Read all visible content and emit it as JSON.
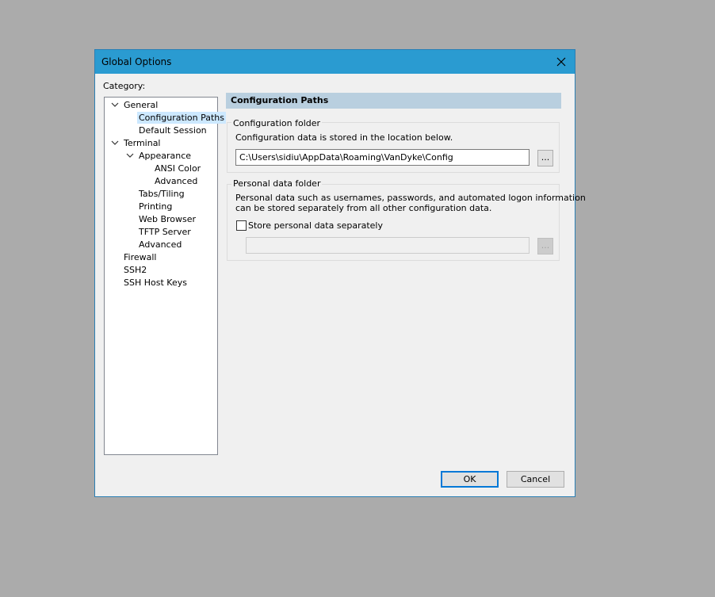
{
  "dialog": {
    "title": "Global Options",
    "category_label": "Category:"
  },
  "tree": [
    {
      "label": "General",
      "expanded": true
    },
    {
      "label": "Configuration Paths",
      "selected": true
    },
    {
      "label": "Default Session"
    },
    {
      "label": "Terminal",
      "expanded": true
    },
    {
      "label": "Appearance",
      "expanded": true
    },
    {
      "label": "ANSI Color"
    },
    {
      "label": "Advanced"
    },
    {
      "label": "Tabs/Tiling"
    },
    {
      "label": "Printing"
    },
    {
      "label": "Web Browser"
    },
    {
      "label": "TFTP Server"
    },
    {
      "label": "Advanced"
    },
    {
      "label": "Firewall"
    },
    {
      "label": "SSH2"
    },
    {
      "label": "SSH Host Keys"
    }
  ],
  "panel": {
    "header": "Configuration Paths",
    "config_folder": {
      "group_label": "Configuration folder",
      "description": "Configuration data is stored in the location below.",
      "path": "C:\\Users\\sidiu\\AppData\\Roaming\\VanDyke\\Config",
      "browse": "..."
    },
    "personal_folder": {
      "group_label": "Personal data folder",
      "description_line1": "Personal data such as usernames, passwords, and automated logon information",
      "description_line2": "can be stored separately from all other configuration data.",
      "checkbox_label": "Store personal data separately",
      "checked": false,
      "path": "",
      "browse": "..."
    }
  },
  "buttons": {
    "ok": "OK",
    "cancel": "Cancel"
  },
  "colors": {
    "titlebar": "#2a9bd1",
    "header_band": "#b9cfdf",
    "selection": "#cce8ff"
  }
}
